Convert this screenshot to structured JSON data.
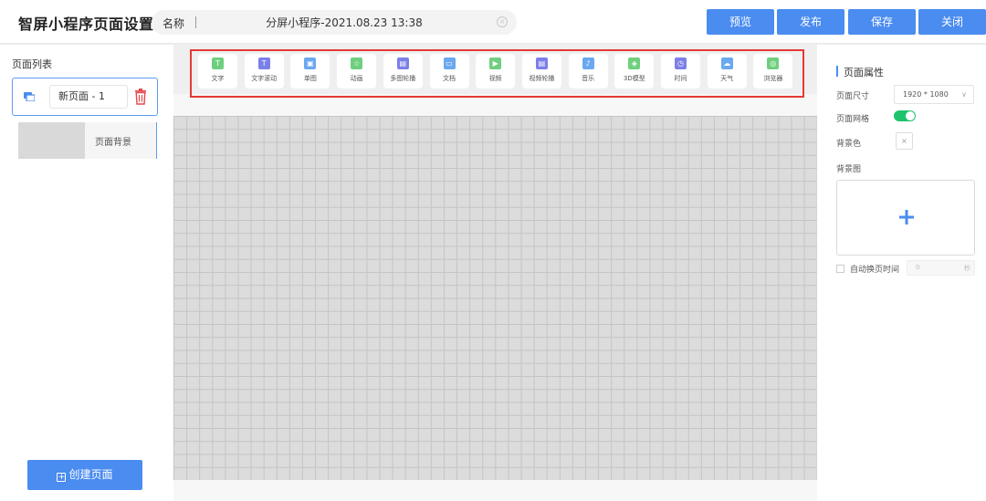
{
  "header": {
    "app_title": "智屏小程序页面设置",
    "name_label": "名称",
    "name_value": "分屏小程序-2021.08.23 13:38",
    "buttons": {
      "preview": "预览",
      "publish": "发布",
      "save": "保存",
      "close": "关闭"
    },
    "accent_color": "#4a8cf0"
  },
  "left_panel": {
    "title": "页面列表",
    "page_item": {
      "name": "新页面 - 1"
    },
    "background_item": {
      "label": "页面背景"
    },
    "create_button": "创建页面"
  },
  "toolbar": {
    "tools": [
      {
        "label": "文字",
        "icon": "text-icon",
        "color": "#6fcf7f"
      },
      {
        "label": "文字滚动",
        "icon": "text-scroll-icon",
        "color": "#7b7fe8"
      },
      {
        "label": "单图",
        "icon": "image-icon",
        "color": "#6aa8f0"
      },
      {
        "label": "动画",
        "icon": "animation-icon",
        "color": "#6fcf7f"
      },
      {
        "label": "多图轮播",
        "icon": "image-carousel-icon",
        "color": "#7b7fe8"
      },
      {
        "label": "文档",
        "icon": "document-icon",
        "color": "#6aa8f0"
      },
      {
        "label": "视频",
        "icon": "video-icon",
        "color": "#6fcf7f"
      },
      {
        "label": "视频轮播",
        "icon": "video-carousel-icon",
        "color": "#7b7fe8"
      },
      {
        "label": "音乐",
        "icon": "music-icon",
        "color": "#6aa8f0"
      },
      {
        "label": "3D模型",
        "icon": "3d-model-icon",
        "color": "#6fcf7f"
      },
      {
        "label": "时间",
        "icon": "clock-icon",
        "color": "#7b7fe8"
      },
      {
        "label": "天气",
        "icon": "weather-icon",
        "color": "#6aa8f0"
      },
      {
        "label": "浏览器",
        "icon": "browser-icon",
        "color": "#6fcf7f"
      }
    ]
  },
  "right_panel": {
    "title": "页面属性",
    "size_label": "页面尺寸",
    "size_value": "1920 * 1080",
    "grid_label": "页面网格",
    "grid_enabled": true,
    "bg_color_label": "背景色",
    "bg_image_label": "背景图",
    "auto_switch_label": "自动换页时间",
    "auto_switch_value": "0",
    "auto_switch_unit": "秒",
    "toggle_color": "#1fc36b"
  }
}
